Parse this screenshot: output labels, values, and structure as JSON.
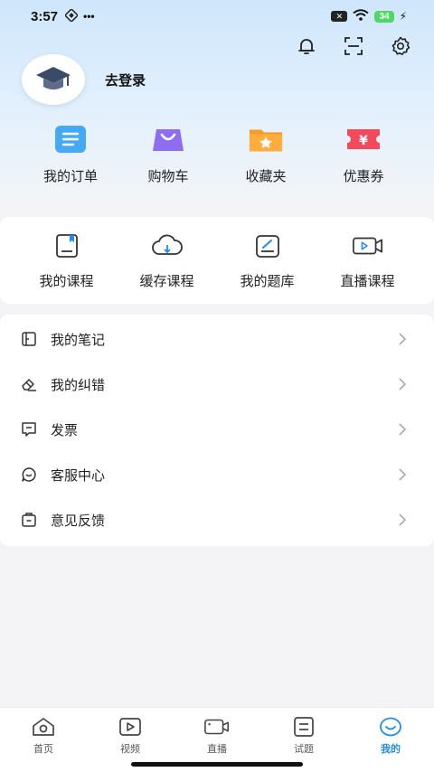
{
  "status_bar": {
    "time": "3:57",
    "battery": "34"
  },
  "profile": {
    "login_label": "去登录"
  },
  "quick_actions": [
    {
      "label": "我的订单",
      "icon": "order-icon",
      "color": "#2b9cf2"
    },
    {
      "label": "购物车",
      "icon": "cart-icon",
      "color": "#8e6df3"
    },
    {
      "label": "收藏夹",
      "icon": "folder-star-icon",
      "color": "#f59b2b"
    },
    {
      "label": "优惠券",
      "icon": "coupon-icon",
      "color": "#f2495d"
    }
  ],
  "courses": [
    {
      "label": "我的课程",
      "icon": "course-book-icon"
    },
    {
      "label": "缓存课程",
      "icon": "cloud-download-icon"
    },
    {
      "label": "我的题库",
      "icon": "question-bank-icon"
    },
    {
      "label": "直播课程",
      "icon": "live-video-icon"
    }
  ],
  "menu": [
    {
      "label": "我的笔记",
      "icon": "note-icon"
    },
    {
      "label": "我的纠错",
      "icon": "eraser-icon"
    },
    {
      "label": "发票",
      "icon": "invoice-icon"
    },
    {
      "label": "客服中心",
      "icon": "customer-service-icon"
    },
    {
      "label": "意见反馈",
      "icon": "feedback-icon"
    }
  ],
  "tabbar": [
    {
      "label": "首页",
      "icon": "home-icon",
      "active": false
    },
    {
      "label": "视频",
      "icon": "video-icon",
      "active": false
    },
    {
      "label": "直播",
      "icon": "live-icon",
      "active": false
    },
    {
      "label": "试题",
      "icon": "exam-icon",
      "active": false
    },
    {
      "label": "我的",
      "icon": "mine-icon",
      "active": true
    }
  ],
  "colors": {
    "accent": "#1e8cf0",
    "header_gradient_top": "#cfe6fb"
  }
}
